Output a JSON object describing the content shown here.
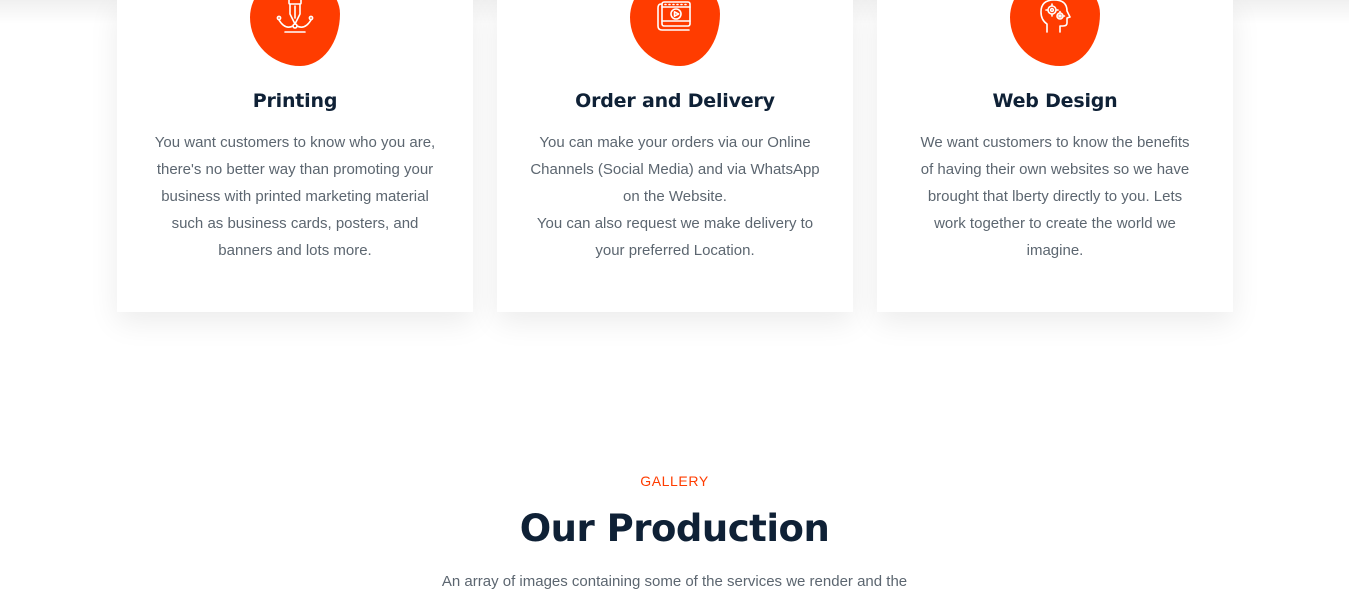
{
  "services": [
    {
      "icon": "pen-tool-icon",
      "title": "Printing",
      "text": "You want customers to know who you are,\nthere's no better way than promoting your\nbusiness with printed marketing material\nsuch as business cards, posters, and\nbanners and lots more."
    },
    {
      "icon": "video-play-icon",
      "title": "Order and Delivery",
      "text": "You can make your orders via our Online\nChannels (Social Media) and via WhatsApp\non the Website.\nYou can also request we make delivery to\nyour preferred Location."
    },
    {
      "icon": "head-gears-icon",
      "title": "Web Design",
      "text": "We want customers to know the benefits\nof having their own websites so we have\nbrought that lberty directly to you. Lets\nwork together to create the world we\nimagine."
    }
  ],
  "gallery": {
    "eyebrow": "GALLERY",
    "title": "Our Production",
    "subtitle": "An array of images containing some of the services we render and the"
  },
  "colors": {
    "accent": "#ff3c00",
    "heading": "#0f2136",
    "body_text": "#5c6670"
  }
}
